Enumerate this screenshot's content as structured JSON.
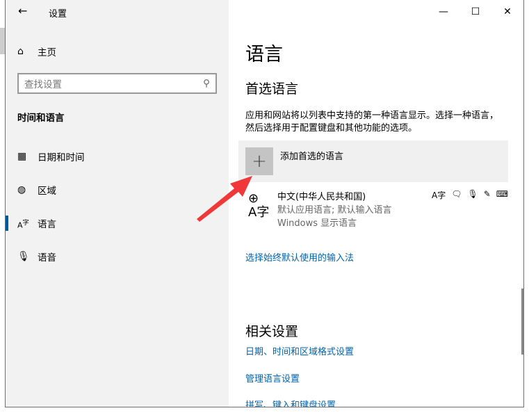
{
  "window": {
    "title": "设置",
    "back_icon": "←",
    "minimize": "—",
    "maximize": "☐",
    "close": "✕"
  },
  "sidebar": {
    "home": "主页",
    "search_placeholder": "查找设置",
    "section": "时间和语言",
    "items": [
      {
        "label": "日期和时间",
        "icon": "calendar-clock-icon"
      },
      {
        "label": "区域",
        "icon": "globe-icon"
      },
      {
        "label": "语言",
        "icon": "language-icon",
        "selected": true
      },
      {
        "label": "语音",
        "icon": "microphone-icon"
      }
    ]
  },
  "main": {
    "title": "语言",
    "preferred_heading": "首选语言",
    "description": "应用和网站将以列表中支持的第一种语言显示。选择一种语言，然后选择用于配置键盘和其他功能的选项。",
    "add_language": "添加首选的语言",
    "language": {
      "name": "中文(中华人民共和国)",
      "detail1": "默认应用语言; 默认输入语言",
      "detail2": "Windows 显示语言"
    },
    "input_method_link": "选择始终默认使用的输入法",
    "related_heading": "相关设置",
    "related_links": [
      "日期、时间和区域格式设置",
      "管理语言设置",
      "拼写、键入和键盘设置"
    ]
  },
  "colors": {
    "accent": "#005a9e",
    "link": "#0063b1",
    "arrow": "#f0373a"
  }
}
